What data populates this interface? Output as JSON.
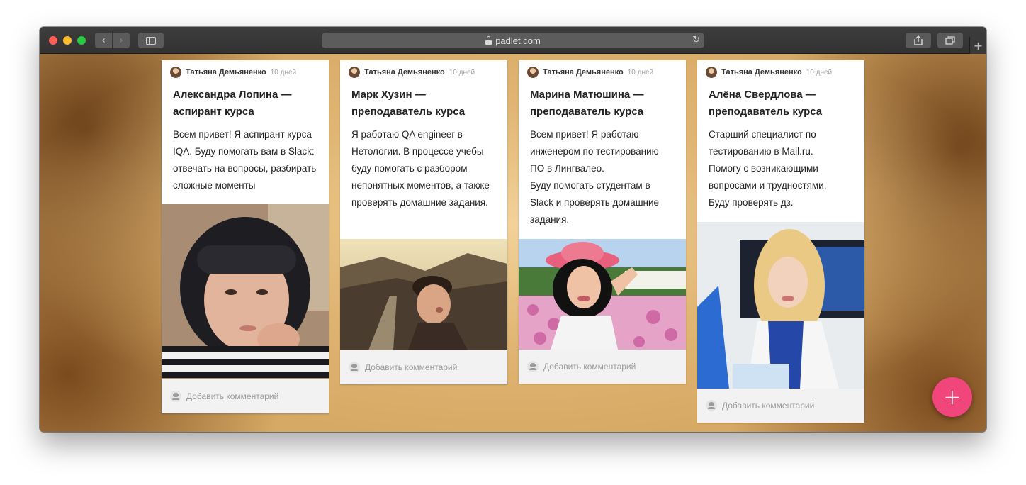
{
  "browser": {
    "url": "padlet.com",
    "back_icon": "chevron-left-icon",
    "forward_icon": "chevron-right-icon",
    "reload_icon": "reload-icon",
    "share_icon": "share-icon",
    "tabs_icon": "tabs-icon",
    "new_tab_icon": "plus-icon"
  },
  "posts": [
    {
      "author": "Татьяна Демьяненко",
      "time": "10 дней",
      "title": "Александра Лопина — аспирант курса",
      "body": "Всем привет! Я аспирант курса IQA. Буду помогать вам в Slack: отвечать на вопросы, разбирать сложные моменты",
      "photo": "portrait-woman-striped-shirt",
      "comment_placeholder": "Добавить комментарий"
    },
    {
      "author": "Татьяна Демьяненко",
      "time": "10 дней",
      "title": "Марк Хузин — преподаватель курса",
      "body": "Я работаю QA engineer в Нетологии. В процессе учебы буду помогать с разбором непонятных моментов, а также проверять домашние задания.",
      "photo": "man-great-wall",
      "comment_placeholder": "Добавить комментарий"
    },
    {
      "author": "Татьяна Демьяненко",
      "time": "10 дней",
      "title": "Марина Матюшина — преподаватель курса",
      "body": "Всем привет! Я работаю инженером по тестированию ПО в Лингвалео.\nБуду помогать студентам в Slack и проверять домашние задания.",
      "photo": "woman-pink-hat-flowers",
      "comment_placeholder": "Добавить комментарий"
    },
    {
      "author": "Татьяна Демьяненко",
      "time": "10 дней",
      "title": "Алёна Свердлова — преподаватель курса",
      "body": "Старший специалист по тестированию в Mail.ru.\nПомогу с возникающими вопросами и трудностями.\nБуду проверять дз.",
      "photo": "blonde-woman-white-jacket",
      "comment_placeholder": "Добавить комментарий"
    }
  ],
  "fab": {
    "label": "+",
    "color": "#f0467c"
  }
}
